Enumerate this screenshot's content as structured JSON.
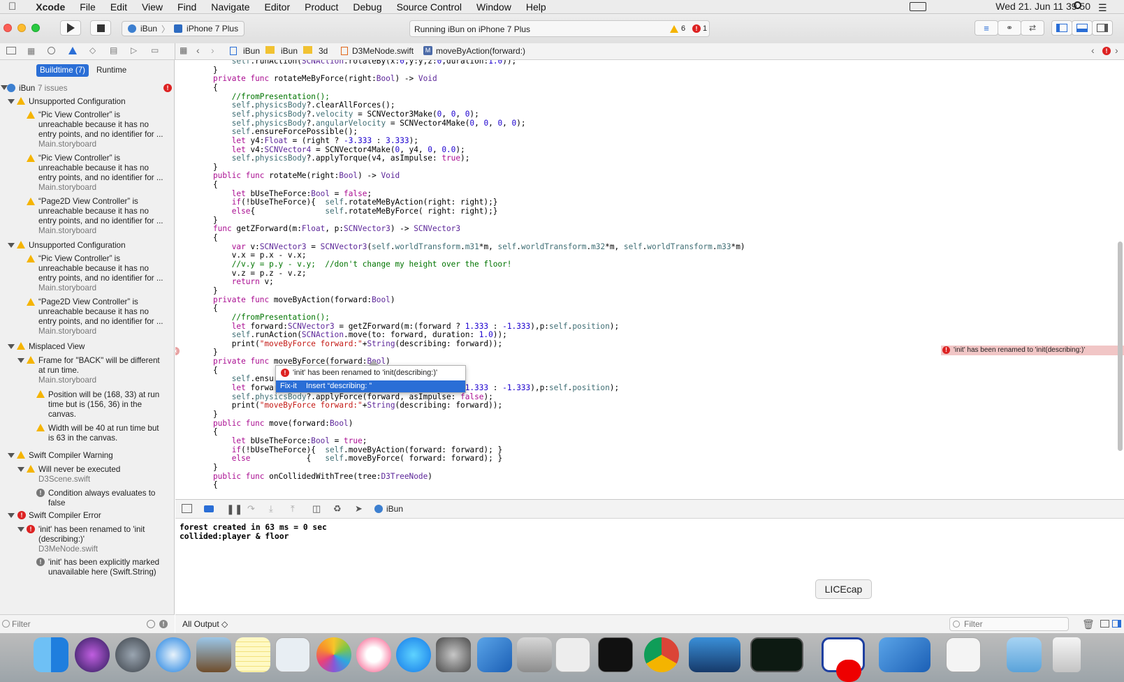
{
  "menubar": {
    "app": "Xcode",
    "items": [
      "File",
      "Edit",
      "View",
      "Find",
      "Navigate",
      "Editor",
      "Product",
      "Debug",
      "Source Control",
      "Window",
      "Help"
    ],
    "clock": "Wed 21. Jun  11 39 50"
  },
  "toolbar": {
    "scheme": "iBun",
    "device": "iPhone 7 Plus",
    "status": "Running iBun on iPhone 7 Plus",
    "warnings": "6",
    "errors": "1"
  },
  "jumpbar": {
    "crumbs": [
      "iBun",
      "iBun",
      "3d",
      "D3MeNode.swift",
      "moveByAction(forward:)"
    ]
  },
  "navigator": {
    "tabs": [
      "Buildtime (7)",
      "Runtime"
    ],
    "project": "iBun",
    "issue_count": "7 issues",
    "groups": [
      {
        "title": "Unsupported Configuration",
        "items": [
          {
            "l1": "“Pic View Controller” is",
            "l2": "unreachable because it has no",
            "l3": "entry points, and no identifier for ...",
            "file": "Main.storyboard"
          },
          {
            "l1": "“Pic View Controller” is",
            "l2": "unreachable because it has no",
            "l3": "entry points, and no identifier for ...",
            "file": "Main.storyboard"
          },
          {
            "l1": "“Page2D View Controller” is",
            "l2": "unreachable because it has no",
            "l3": "entry points, and no identifier for ...",
            "file": "Main.storyboard"
          }
        ]
      },
      {
        "title": "Unsupported Configuration",
        "items": [
          {
            "l1": "“Pic View Controller” is",
            "l2": "unreachable because it has no",
            "l3": "entry points, and no identifier for ...",
            "file": "Main.storyboard"
          },
          {
            "l1": "“Page2D View Controller” is",
            "l2": "unreachable because it has no",
            "l3": "entry points, and no identifier for ...",
            "file": "Main.storyboard"
          }
        ]
      },
      {
        "title": "Misplaced View",
        "items": [
          {
            "l1": "Frame for \"BACK\" will be different",
            "l2": "at run time.",
            "file": "Main.storyboard"
          },
          {
            "l1": "Position will be (168, 33) at run",
            "l2": "time but is (156, 36) in the",
            "l3": "canvas."
          },
          {
            "l1": "Width will be 40 at run time but",
            "l2": "is 63 in the canvas."
          }
        ]
      },
      {
        "title": "Swift Compiler Warning",
        "items": [
          {
            "l1": "Will never be executed",
            "file": "D3Scene.swift"
          },
          {
            "l1": "Condition always evaluates to",
            "l2": "false"
          }
        ]
      },
      {
        "title": "Swift Compiler Error",
        "items": [
          {
            "l1": "'init' has been renamed to 'init",
            "l2": "(describing:)'",
            "file": "D3MeNode.swift"
          },
          {
            "l1": "'init' has been explicitly marked",
            "l2": "unavailable here (Swift.String)"
          }
        ]
      }
    ],
    "filter_placeholder": "Filter"
  },
  "editor": {
    "lines": [
      "    self.runAction(SCNAction.rotateBy(x:0,y:y,z:0,duration:1.0));",
      "}",
      "private func rotateMeByForce(right:Bool) -> Void",
      "{",
      "    //fromPresentation();",
      "    self.physicsBody?.clearAllForces();",
      "    self.physicsBody?.velocity = SCNVector3Make(0, 0, 0);",
      "    self.physicsBody?.angularVelocity = SCNVector4Make(0, 0, 0, 0);",
      "    self.ensureForcePossible();",
      "    let y4:Float = (right ? -3.333 : 3.333);",
      "    let v4:SCNVector4 = SCNVector4Make(0, y4, 0, 0.0);",
      "    self.physicsBody?.applyTorque(v4, asImpulse: true);",
      "}",
      "public func rotateMe(right:Bool) -> Void",
      "{",
      "    let bUseTheForce:Bool = false;",
      "    if(!bUseTheForce){  self.rotateMeByAction(right: right);}",
      "    else{               self.rotateMeByForce( right: right);}",
      "}",
      "func getZForward(m:Float, p:SCNVector3) -> SCNVector3",
      "{",
      "    var v:SCNVector3 = SCNVector3(self.worldTransform.m31*m, self.worldTransform.m32*m, self.worldTransform.m33*m)",
      "    v.x = p.x - v.x;",
      "    //v.y = p.y - v.y;  //don't change my height over the floor!",
      "    v.z = p.z - v.z;",
      "    return v;",
      "}",
      "private func moveByAction(forward:Bool)",
      "{",
      "    //fromPresentation();",
      "    let forward:SCNVector3 = getZForward(m:(forward ? 1.333 : -1.333),p:self.position);",
      "    self.runAction(SCNAction.move(to: forward, duration: 1.0));",
      "    print(\"moveByForce forward:\"+String(describing: forward));",
      "}",
      "private func moveByForce(forward:Bool)",
      "{",
      "    self.ensureForcePossible();",
      "    let forward:SCNVector3 = getZForward(m:(forward ? 1.333 : -1.333),p:self.position);",
      "    self.physicsBody?.applyForce(forward, asImpulse: false);",
      "    print(\"moveByForce forward:\"+String(describing: forward));",
      "}",
      "public func move(forward:Bool)",
      "{",
      "    let bUseTheForce:Bool = true;",
      "    if(!bUseTheForce){  self.moveByAction(forward: forward); }",
      "    else            {   self.moveByForce( forward: forward); }",
      "}",
      "public func onCollidedWithTree(tree:D3TreeNode)",
      "{"
    ],
    "inline_error": "'init' has been renamed to 'init(describing:)'",
    "popup_message": "'init' has been renamed to 'init(describing:)'",
    "popup_fixit_label": "Fix-it",
    "popup_fixit_action": "Insert “describing: ”"
  },
  "debug": {
    "target": "iBun",
    "console_lines": [
      "forest created in 63 ms = 0 sec",
      "collided:player & floor"
    ],
    "output_selector": "All Output ◇",
    "filter_placeholder": "Filter"
  },
  "tooltip": "LICEcap"
}
